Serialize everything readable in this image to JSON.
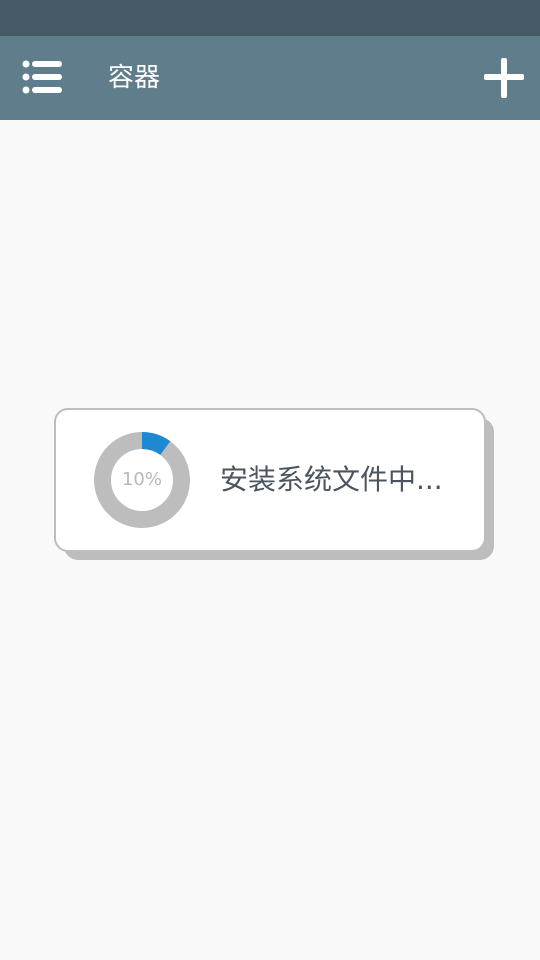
{
  "app_bar": {
    "title": "容器",
    "menu_icon": "list-menu-icon",
    "add_icon": "plus-icon"
  },
  "dialog": {
    "progress_fraction": 0.1,
    "progress_label": "10%",
    "message": "安装系统文件中..."
  },
  "colors": {
    "status_bar": "#455a64",
    "app_bar": "#607d8b",
    "background": "#f9f9f9",
    "progress_track": "#bdbdbd",
    "progress_fill": "#1e88d2"
  }
}
